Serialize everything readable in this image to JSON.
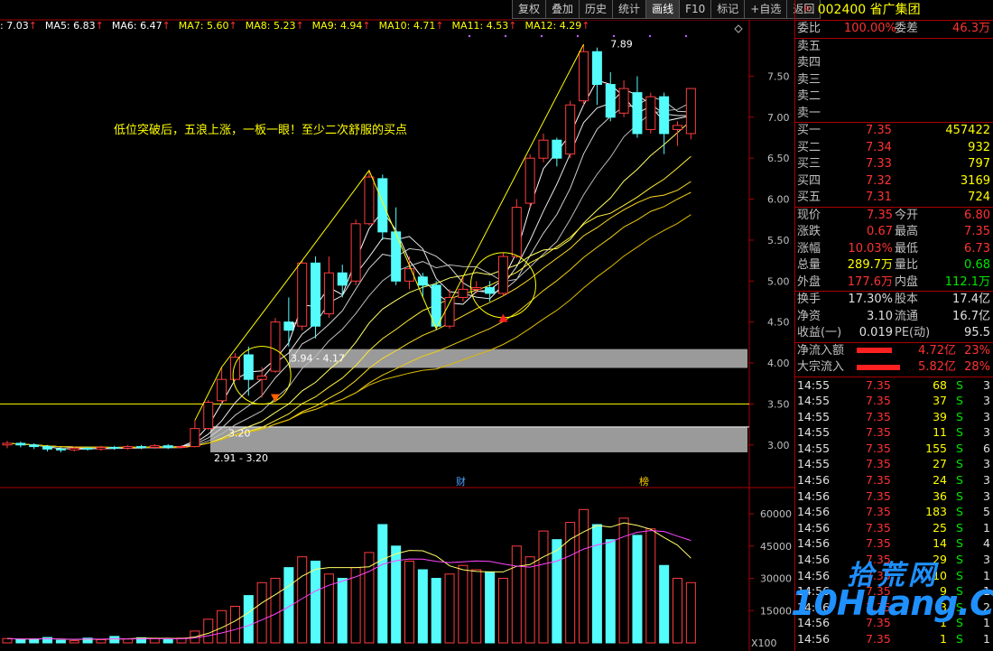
{
  "toolbar": {
    "buttons": [
      "复权",
      "叠加",
      "历史",
      "统计",
      "画线",
      "F10",
      "标记",
      "+自选",
      "返回"
    ]
  },
  "ma_bar": [
    {
      "label": ": 7.03",
      "color": "#ffffff"
    },
    {
      "label": "MA5: 6.83",
      "color": "#ffffff"
    },
    {
      "label": "MA6: 6.47",
      "color": "#ffffff"
    },
    {
      "label": "MA7: 5.60",
      "color": "#ffff00"
    },
    {
      "label": "MA8: 5.23",
      "color": "#ffff00"
    },
    {
      "label": "MA9: 4.94",
      "color": "#ffff00"
    },
    {
      "label": "MA10: 4.71",
      "color": "#ffff00"
    },
    {
      "label": "MA11: 4.53",
      "color": "#ffff00"
    },
    {
      "label": "MA12: 4.29",
      "color": "#ffff00"
    }
  ],
  "annotation": "低位突破后，五浪上涨，一板一眼！至少二次舒服的买点",
  "chart_labels": {
    "high": "7.89",
    "zone_upper": "3.94 - 4.17",
    "zone_lower": "2.91 - 3.20",
    "zone_lower_partial": "3.20",
    "marker_T": "T",
    "marker_cai": "财",
    "marker_bang": "榜",
    "x100": "X100"
  },
  "price_axis": [
    "7.50",
    "7.00",
    "6.50",
    "6.00",
    "5.50",
    "5.00",
    "4.50",
    "4.00",
    "3.50",
    "3.00"
  ],
  "volume_axis": [
    "60000",
    "45000",
    "30000",
    "15000"
  ],
  "chart_data": [
    {
      "type": "candlestick",
      "title": "",
      "y_unit": "price",
      "ylim": [
        2.7,
        8.1
      ],
      "candles": [
        [
          3.0,
          3.02,
          2.96,
          3.05
        ],
        [
          3.02,
          3.0,
          2.97,
          3.04
        ],
        [
          3.0,
          2.98,
          2.95,
          3.02
        ],
        [
          2.98,
          2.95,
          2.92,
          3.0
        ],
        [
          2.95,
          2.94,
          2.91,
          2.97
        ],
        [
          2.94,
          2.96,
          2.92,
          2.98
        ],
        [
          2.96,
          2.95,
          2.93,
          2.98
        ],
        [
          2.95,
          2.97,
          2.93,
          2.99
        ],
        [
          2.97,
          2.96,
          2.94,
          2.99
        ],
        [
          2.96,
          2.98,
          2.94,
          3.0
        ],
        [
          2.98,
          2.97,
          2.95,
          3.0
        ],
        [
          2.97,
          2.99,
          2.95,
          3.01
        ],
        [
          2.99,
          2.97,
          2.95,
          3.01
        ],
        [
          2.97,
          2.98,
          2.96,
          3.0
        ],
        [
          2.98,
          3.2,
          2.97,
          3.3
        ],
        [
          3.2,
          3.52,
          3.18,
          3.55
        ],
        [
          3.54,
          3.8,
          3.5,
          3.95
        ],
        [
          3.8,
          4.07,
          3.78,
          4.12
        ],
        [
          4.1,
          3.8,
          3.6,
          4.2
        ],
        [
          3.8,
          3.84,
          3.58,
          3.95
        ],
        [
          3.9,
          4.5,
          3.88,
          4.55
        ],
        [
          4.5,
          4.4,
          4.2,
          4.8
        ],
        [
          4.45,
          5.22,
          4.4,
          5.25
        ],
        [
          5.22,
          4.45,
          4.3,
          5.3
        ],
        [
          4.6,
          5.1,
          4.55,
          5.3
        ],
        [
          5.1,
          4.95,
          4.8,
          5.2
        ],
        [
          5.0,
          5.7,
          4.95,
          5.75
        ],
        [
          5.7,
          6.27,
          5.68,
          6.35
        ],
        [
          6.25,
          5.6,
          5.5,
          6.3
        ],
        [
          5.6,
          5.0,
          4.95,
          5.9
        ],
        [
          5.0,
          5.15,
          4.9,
          5.3
        ],
        [
          5.05,
          4.95,
          4.8,
          5.1
        ],
        [
          4.95,
          4.45,
          4.4,
          5.0
        ],
        [
          4.45,
          4.8,
          4.42,
          4.9
        ],
        [
          4.8,
          4.9,
          4.75,
          5.05
        ],
        [
          4.9,
          4.92,
          4.85,
          5.0
        ],
        [
          4.92,
          4.85,
          4.75,
          5.0
        ],
        [
          4.85,
          5.3,
          4.82,
          5.35
        ],
        [
          5.3,
          5.9,
          5.28,
          6.0
        ],
        [
          5.95,
          6.5,
          5.9,
          6.55
        ],
        [
          6.5,
          6.72,
          6.45,
          6.8
        ],
        [
          6.72,
          6.5,
          6.4,
          6.75
        ],
        [
          6.55,
          7.15,
          6.5,
          7.2
        ],
        [
          7.2,
          7.8,
          7.15,
          7.89
        ],
        [
          7.8,
          7.4,
          7.15,
          7.85
        ],
        [
          7.4,
          7.0,
          6.95,
          7.55
        ],
        [
          7.05,
          7.35,
          7.0,
          7.45
        ],
        [
          7.3,
          6.8,
          6.75,
          7.5
        ],
        [
          6.85,
          7.25,
          6.8,
          7.3
        ],
        [
          7.25,
          6.8,
          6.55,
          7.3
        ],
        [
          6.85,
          6.9,
          6.65,
          6.95
        ],
        [
          6.8,
          7.35,
          6.73,
          7.35
        ]
      ]
    },
    {
      "type": "bar",
      "title": "",
      "y_unit": "volume",
      "ylim": [
        0,
        68000
      ],
      "values": [
        2000,
        1500,
        1800,
        2500,
        1200,
        1000,
        2200,
        1500,
        3000,
        1800,
        2400,
        2000,
        1600,
        2200,
        5500,
        11000,
        15000,
        17000,
        22000,
        28000,
        30000,
        35000,
        40000,
        38000,
        32000,
        30000,
        35000,
        42000,
        55000,
        45000,
        38000,
        34000,
        30000,
        32000,
        36000,
        34000,
        33000,
        30000,
        45000,
        40000,
        52000,
        48000,
        56000,
        62000,
        55000,
        48000,
        58000,
        50000,
        53000,
        36000,
        30000,
        28000
      ]
    }
  ],
  "panel": {
    "code": "002400",
    "name": "省广集团",
    "r_mark": "R",
    "weibi_label": "委比",
    "weibi_value": "100.00%",
    "weicha_label": "委差",
    "weicha_value": "46.3万",
    "sells": [
      "卖五",
      "卖四",
      "卖三",
      "卖二",
      "卖一"
    ],
    "buys": [
      {
        "label": "买一",
        "price": "7.35",
        "vol": "457422"
      },
      {
        "label": "买二",
        "price": "7.34",
        "vol": "932"
      },
      {
        "label": "买三",
        "price": "7.33",
        "vol": "797"
      },
      {
        "label": "买四",
        "price": "7.32",
        "vol": "3169"
      },
      {
        "label": "买五",
        "price": "7.31",
        "vol": "724"
      }
    ],
    "stats": [
      {
        "l1": "现价",
        "v1": "7.35",
        "c1": "red",
        "l2": "今开",
        "v2": "6.80",
        "c2": "red"
      },
      {
        "l1": "涨跌",
        "v1": "0.67",
        "c1": "red",
        "l2": "最高",
        "v2": "7.35",
        "c2": "red"
      },
      {
        "l1": "涨幅",
        "v1": "10.03%",
        "c1": "red",
        "l2": "最低",
        "v2": "6.73",
        "c2": "red"
      },
      {
        "l1": "总量",
        "v1": "289.7万",
        "c1": "yel",
        "l2": "量比",
        "v2": "0.68",
        "c2": "grn"
      },
      {
        "l1": "外盘",
        "v1": "177.6万",
        "c1": "red",
        "l2": "内盘",
        "v2": "112.1万",
        "c2": "grn"
      }
    ],
    "stats2": [
      {
        "l1": "换手",
        "v1": "17.30%",
        "l2": "股本",
        "v2": "17.4亿"
      },
      {
        "l1": "净资",
        "v1": "3.10",
        "l2": "流通",
        "v2": "16.7亿"
      },
      {
        "l1": "收益(一)",
        "v1": "0.019",
        "l2": "PE(动)",
        "v2": "95.5"
      }
    ],
    "flows": [
      {
        "label": "净流入额",
        "value": "4.72亿",
        "pct": "23%",
        "fill": 0.23
      },
      {
        "label": "大宗流入",
        "value": "5.82亿",
        "pct": "28%",
        "fill": 0.28
      }
    ],
    "ticks": [
      {
        "t": "14:55",
        "p": "7.35",
        "v": "68",
        "s": "S",
        "n": "3"
      },
      {
        "t": "14:55",
        "p": "7.35",
        "v": "37",
        "s": "S",
        "n": "3"
      },
      {
        "t": "14:55",
        "p": "7.35",
        "v": "39",
        "s": "S",
        "n": "3"
      },
      {
        "t": "14:55",
        "p": "7.35",
        "v": "11",
        "s": "S",
        "n": "3"
      },
      {
        "t": "14:55",
        "p": "7.35",
        "v": "155",
        "s": "S",
        "n": "6"
      },
      {
        "t": "14:55",
        "p": "7.35",
        "v": "27",
        "s": "S",
        "n": "3"
      },
      {
        "t": "14:56",
        "p": "7.35",
        "v": "24",
        "s": "S",
        "n": "3"
      },
      {
        "t": "14:56",
        "p": "7.35",
        "v": "36",
        "s": "S",
        "n": "3"
      },
      {
        "t": "14:56",
        "p": "7.35",
        "v": "183",
        "s": "S",
        "n": "5"
      },
      {
        "t": "14:56",
        "p": "7.35",
        "v": "25",
        "s": "S",
        "n": "1"
      },
      {
        "t": "14:56",
        "p": "7.35",
        "v": "14",
        "s": "S",
        "n": "4"
      },
      {
        "t": "14:56",
        "p": "7.35",
        "v": "29",
        "s": "S",
        "n": "3"
      },
      {
        "t": "14:56",
        "p": "7.35",
        "v": "10",
        "s": "S",
        "n": "1"
      },
      {
        "t": "14:56",
        "p": "7.35",
        "v": "9",
        "s": "S",
        "n": "1"
      },
      {
        "t": "14:56",
        "p": "7.35",
        "v": "3",
        "s": "S",
        "n": "2"
      },
      {
        "t": "14:56",
        "p": "7.35",
        "v": "1",
        "s": "S",
        "n": "1"
      },
      {
        "t": "14:56",
        "p": "7.35",
        "v": "1",
        "s": "S",
        "n": "1"
      }
    ]
  },
  "watermark": {
    "line1": "拾荒网",
    "line2": "10Huang.CN"
  }
}
